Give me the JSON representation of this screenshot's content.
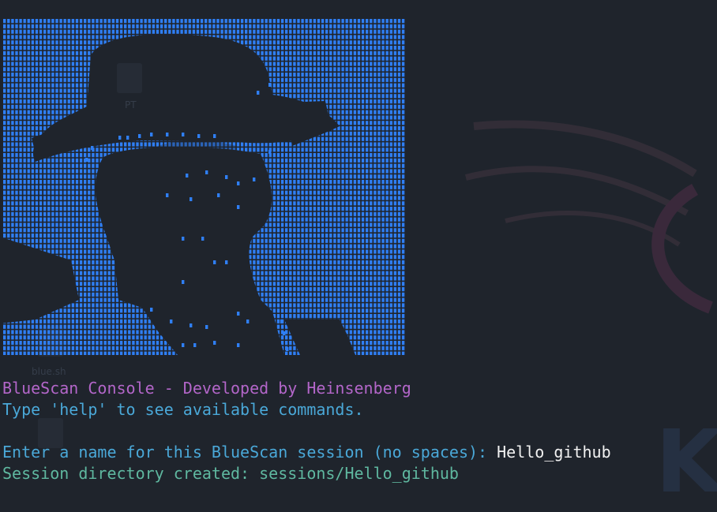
{
  "desktop": {
    "icon_labels": [
      "PT",
      "blue.sh"
    ],
    "watermark_letter": "K"
  },
  "ascii_art": {
    "description_icon": "ascii-portrait-art",
    "color": "#2f7ff5"
  },
  "terminal": {
    "lines": {
      "title": "BlueScan Console - Developed by Heinsenberg",
      "help": "Type 'help' to see available commands.",
      "prompt": "Enter a name for this BlueScan session (no spaces): ",
      "prompt_input": "Hello_github",
      "created": "Session directory created: sessions/Hello_github"
    },
    "colors": {
      "title": "#b366c9",
      "help": "#4aa8d8",
      "input": "#f2f2f2",
      "created": "#5fb8a0"
    }
  }
}
